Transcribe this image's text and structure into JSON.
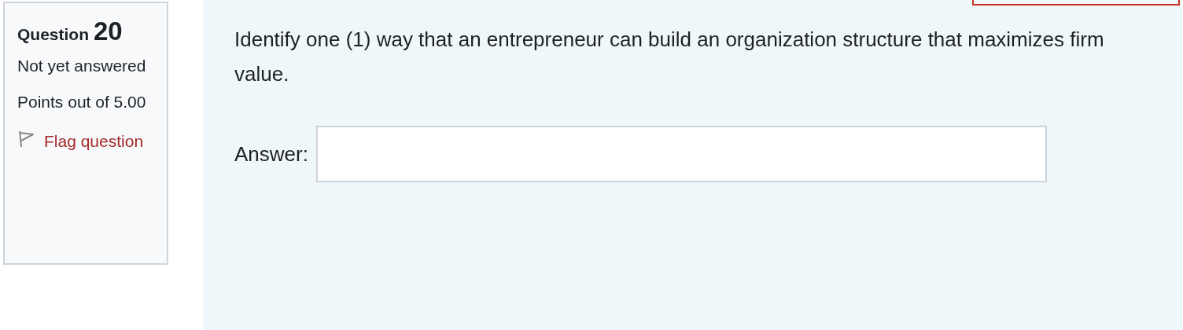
{
  "info": {
    "label": "Question",
    "number": "20",
    "state": "Not yet answered",
    "grade": "Points out of 5.00",
    "flag": {
      "label": "Flag question",
      "flagged": false
    }
  },
  "question": {
    "text": "Identify one (1) way that an entrepreneur can build an organization structure that maximizes firm value.",
    "answer_label": "Answer:"
  }
}
